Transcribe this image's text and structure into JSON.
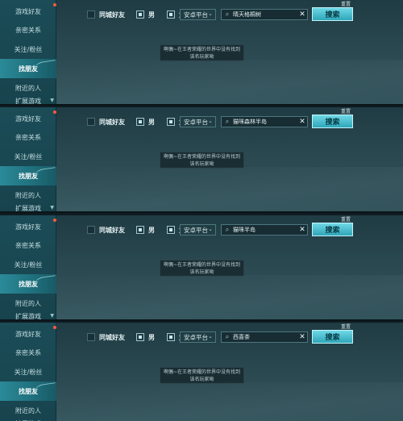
{
  "sidebar": {
    "items": [
      "游戏好友",
      "亲密关系",
      "关注/粉丝",
      "找朋友",
      "附近的人",
      "扩展游戏"
    ],
    "active_index": 3
  },
  "filters": {
    "same_city_label": "同城好友",
    "male_label": "男",
    "female_label": "女",
    "platform_selected": "安卓平台"
  },
  "reset_label": "重置",
  "search_button_label": "搜索",
  "empty_message_line1": "啊偶~在王者荣耀的世界中没有找到",
  "empty_message_line2": "该名玩家呦",
  "panels": [
    {
      "search_value": "晴天格桐树"
    },
    {
      "search_value": "猫咪森林半岛"
    },
    {
      "search_value": "猫咪半岛"
    },
    {
      "search_value": "西喜茶"
    }
  ],
  "colors": {
    "accent": "#3fb8c8",
    "notification_dot": "#ff5a3c"
  },
  "icons": {
    "search": "search-icon",
    "clear": "close-icon",
    "dropdown": "chevron-down-icon"
  }
}
